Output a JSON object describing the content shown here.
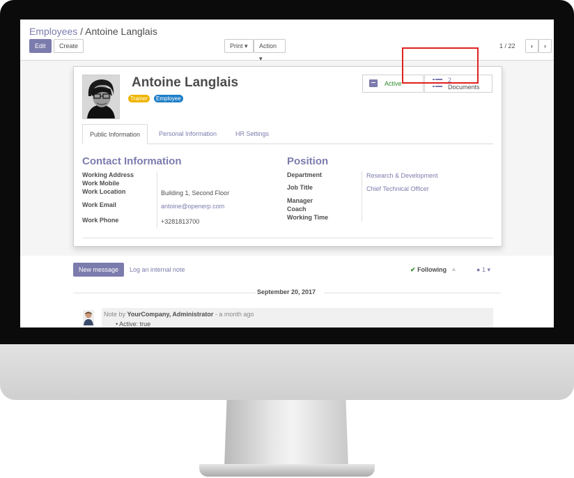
{
  "breadcrumb": {
    "parent": "Employees",
    "separator": "/",
    "current": "Antoine Langlais"
  },
  "control_panel": {
    "edit_label": "Edit",
    "create_label": "Create",
    "print_label": "Print",
    "action_label": "Action",
    "pager": "1 / 22"
  },
  "employee": {
    "name": "Antoine Langlais",
    "tags": [
      {
        "label": "Trainer",
        "color": "#f0b400"
      },
      {
        "label": "Employee",
        "color": "#1f7fc7"
      }
    ]
  },
  "stat_buttons": {
    "active_label": "Active",
    "documents_count": "2",
    "documents_label": "Documents"
  },
  "tabs": [
    {
      "label": "Public Information"
    },
    {
      "label": "Personal Information"
    },
    {
      "label": "HR Settings"
    }
  ],
  "contact": {
    "title": "Contact Information",
    "working_address_label": "Working Address",
    "work_mobile_label": "Work Mobile",
    "work_location_label": "Work Location",
    "work_location": "Building 1, Second Floor",
    "work_email_label": "Work Email",
    "work_email": "antoine@openerp.com",
    "work_phone_label": "Work Phone",
    "work_phone": "+3281813700"
  },
  "position": {
    "title": "Position",
    "department_label": "Department",
    "department": "Research & Development",
    "job_title_label": "Job Title",
    "job_title": "Chief Technical Officer",
    "manager_label": "Manager",
    "coach_label": "Coach",
    "working_time_label": "Working Time"
  },
  "chatter": {
    "new_message": "New message",
    "log_note": "Log an internal note",
    "following": "Following",
    "followers_count": "1",
    "date": "September 20, 2017",
    "note_prefix": "Note by",
    "note_author": "YourCompany, Administrator",
    "note_time": "- a month ago",
    "note_item": "Active: true"
  },
  "colors": {
    "brand": "#7c7bad",
    "highlight": "#e02020",
    "active_green": "#2e8b2e"
  }
}
